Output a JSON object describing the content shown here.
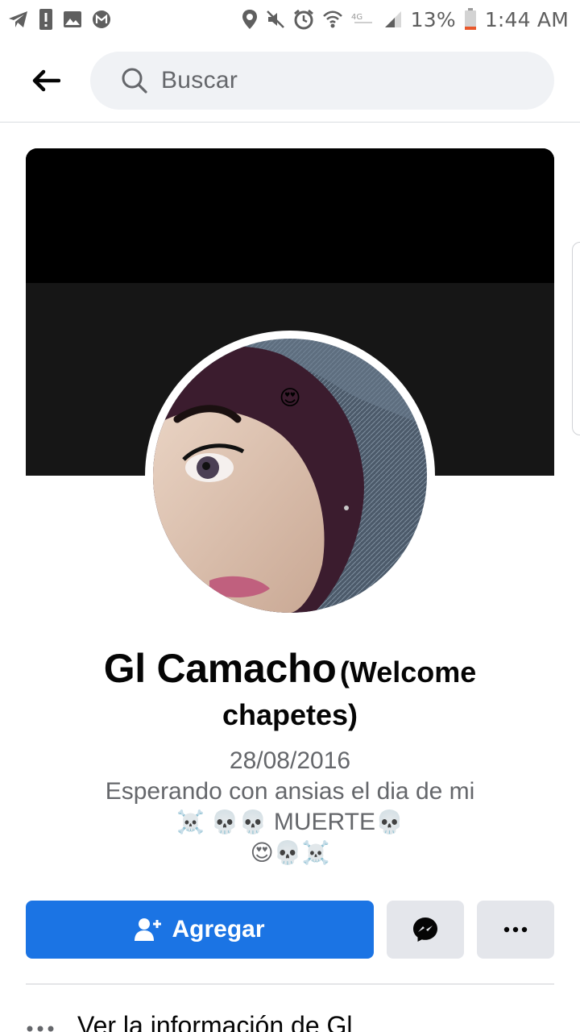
{
  "status_bar": {
    "battery": "13%",
    "time": "1:44 AM",
    "network_label": "4G"
  },
  "search": {
    "placeholder": "Buscar"
  },
  "profile": {
    "name": "Gl Camacho",
    "alt_name_line1": "(Welcome",
    "alt_name_line2": "chapetes)",
    "date": "28/08/2016",
    "bio_line1": "Esperando con ansias el dia de mi",
    "bio_line2_emoji_a": "☠️  💀💀",
    "bio_line2_text": "MUERTE",
    "bio_line2_emoji_b": "💀",
    "bio_line3": "😍💀☠️",
    "photo_emoji": "😍"
  },
  "actions": {
    "add_label": "Agregar"
  },
  "info": {
    "label": "Ver la información de Gl"
  },
  "colors": {
    "accent": "#1b74e4",
    "secondary_button": "#e4e6eb",
    "search_bg": "#f0f2f5",
    "muted_text": "#65676b"
  }
}
